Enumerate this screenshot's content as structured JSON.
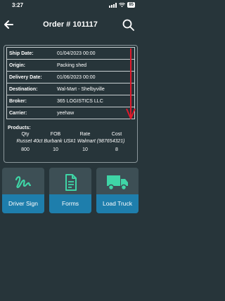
{
  "status_bar": {
    "time": "3:27",
    "battery": "85"
  },
  "header": {
    "title": "Order # 101117"
  },
  "order": {
    "rows": [
      {
        "label": "Ship Date:",
        "value": "01/04/2023 00:00"
      },
      {
        "label": "Origin:",
        "value": "Packing shed"
      },
      {
        "label": "Delivery Date:",
        "value": "01/06/2023 00:00"
      },
      {
        "label": "Destination:",
        "value": "Wal-Mart - Shelbyville"
      },
      {
        "label": "Broker:",
        "value": "365 LOGISTICS LLC"
      },
      {
        "label": "Carrier:",
        "value": "yeehaw"
      }
    ]
  },
  "products": {
    "title": "Products:",
    "columns": [
      "Qty",
      "FOB",
      "Rate",
      "Cost"
    ],
    "items": [
      {
        "name": "Russet 40ct Burbank US#1 Walmart (987654321)",
        "qty": "800",
        "fob": "10",
        "rate": "10",
        "cost": "8"
      }
    ]
  },
  "actions": [
    {
      "label": "Driver Sign",
      "icon": "signature-icon"
    },
    {
      "label": "Forms",
      "icon": "document-icon"
    },
    {
      "label": "Load Truck",
      "icon": "truck-icon"
    }
  ],
  "colors": {
    "background": "#27353a",
    "tile": "#3d4f55",
    "tile_label": "#1e7eac",
    "icon_green": "#3fd5a6",
    "arrow_red": "#e3192b"
  }
}
